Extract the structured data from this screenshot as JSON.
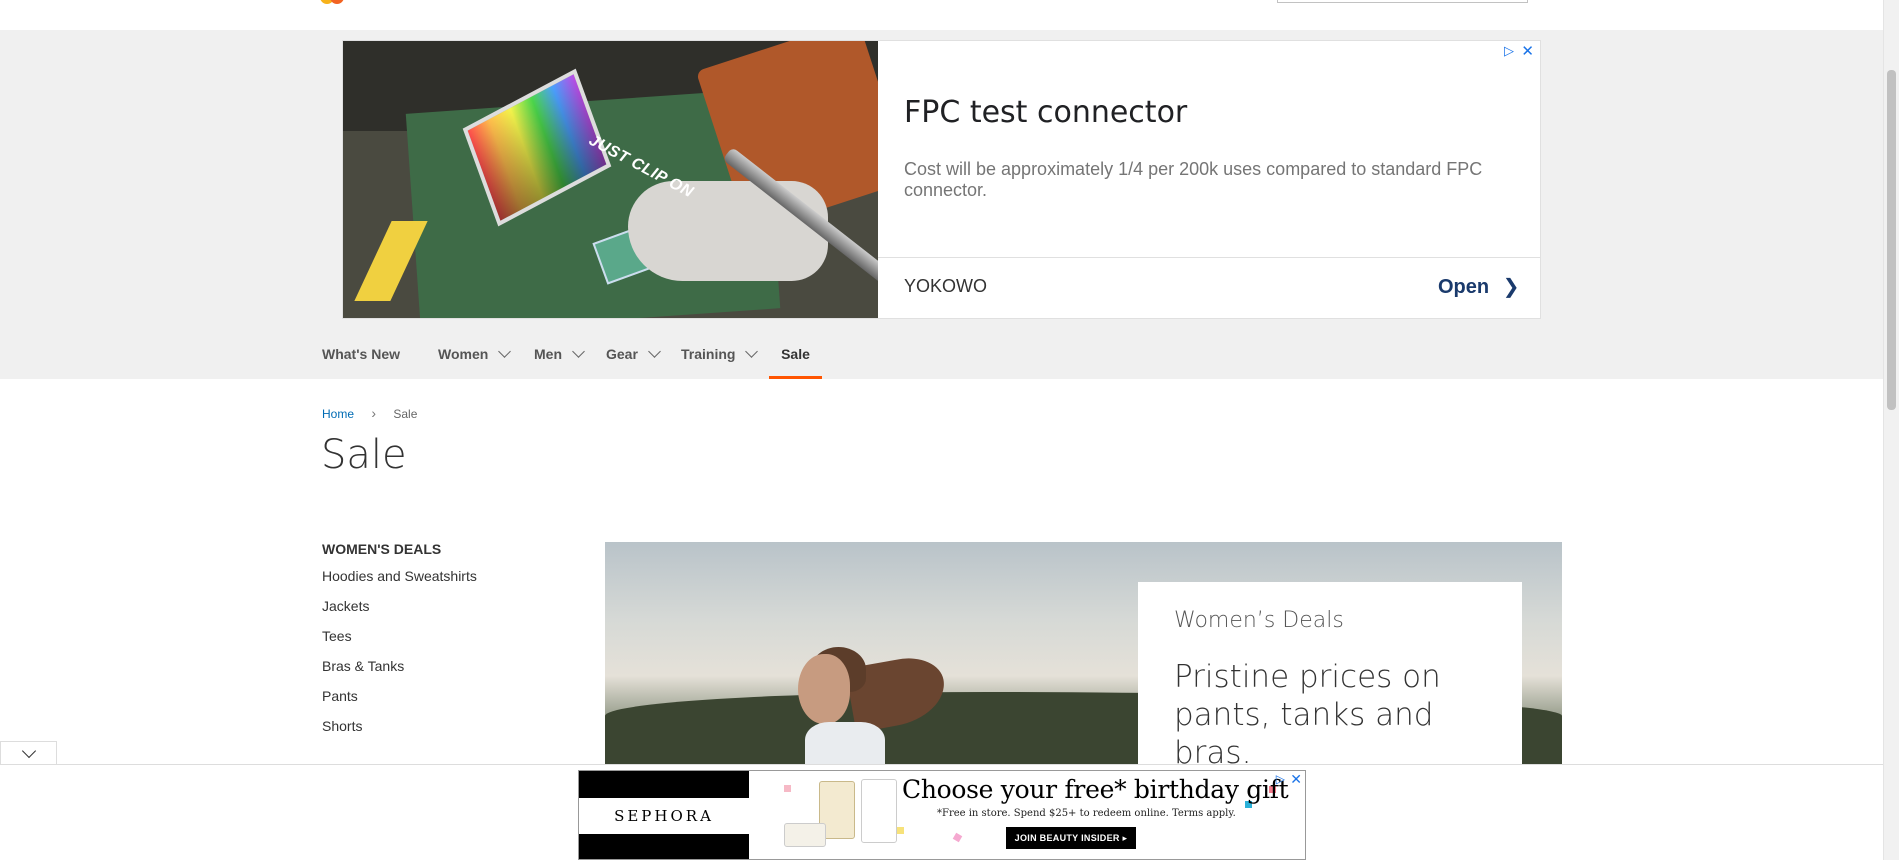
{
  "ad": {
    "title": "FPC test connector",
    "description": "Cost will be approximately 1/4 per 200k uses compared to standard FPC connector.",
    "advertiser": "YOKOWO",
    "open_label": "Open",
    "image_text": "JUST CLIP ON",
    "adchoices_icon": "play-triangle",
    "close_icon": "close-x"
  },
  "nav": {
    "items": [
      {
        "label": "What's New"
      },
      {
        "label": "Women"
      },
      {
        "label": "Men"
      },
      {
        "label": "Gear"
      },
      {
        "label": "Training"
      },
      {
        "label": "Sale"
      }
    ],
    "active": "Sale",
    "accent_color": "#ff5501"
  },
  "breadcrumb": {
    "home": "Home",
    "current": "Sale"
  },
  "page_title": "Sale",
  "sidebar": {
    "heading": "WOMEN'S DEALS",
    "links": [
      "Hoodies and Sweatshirts",
      "Jackets",
      "Tees",
      "Bras & Tanks",
      "Pants",
      "Shorts"
    ]
  },
  "hero": {
    "kicker": "Women’s Deals",
    "headline": "Pristine prices on pants, tanks and bras."
  },
  "sticky_ad": {
    "brand": "SEPHORA",
    "headline": "Choose your free* birthday gift",
    "fine_print": "*Free in store. Spend $25+ to redeem online. Terms apply.",
    "cta": "JOIN BEAUTY INSIDER ▸"
  }
}
